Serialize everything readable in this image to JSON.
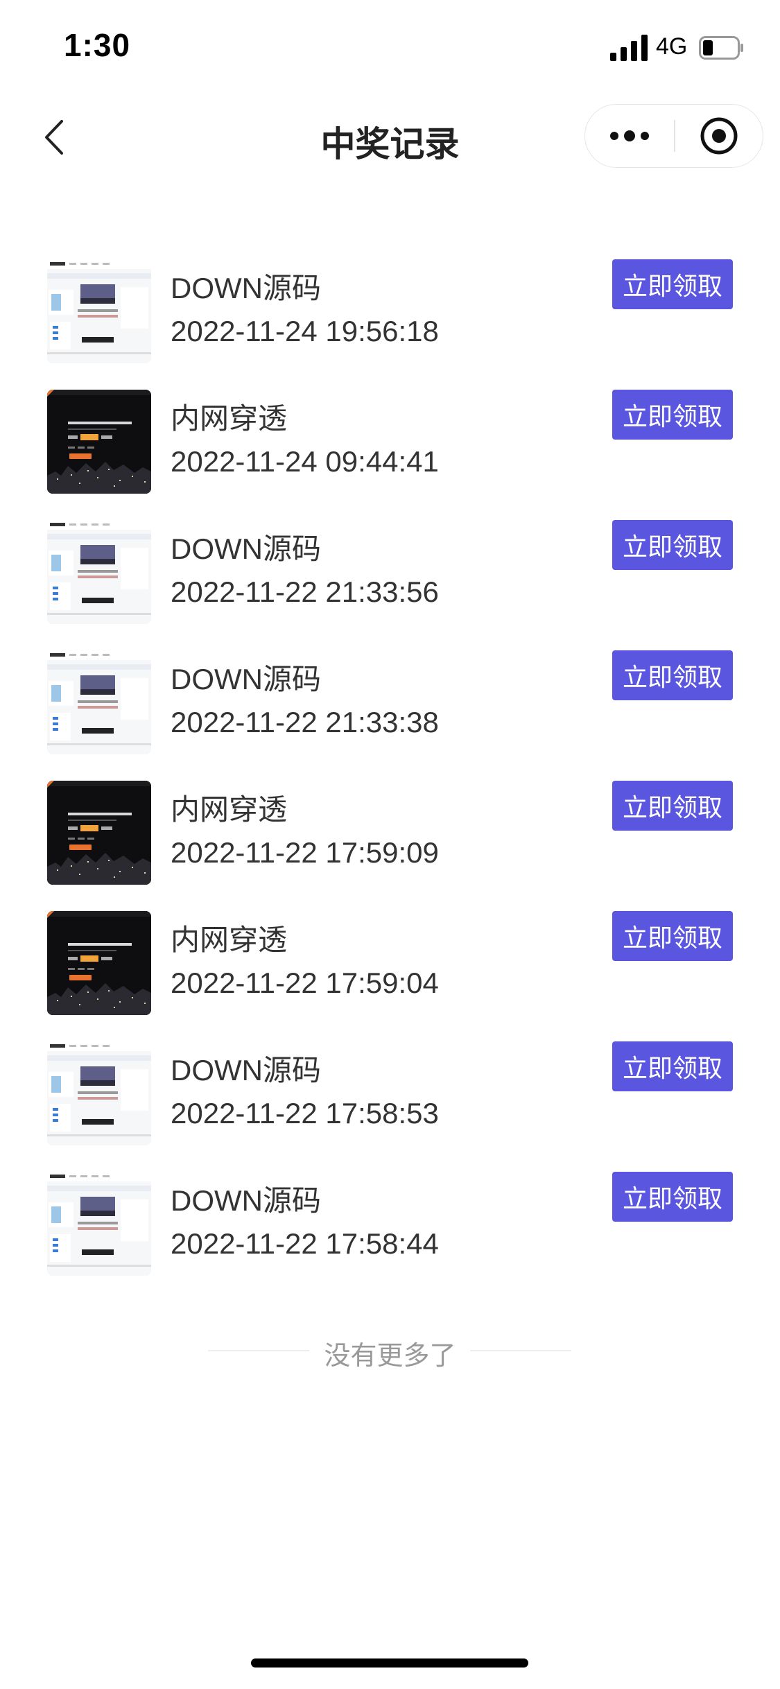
{
  "status_bar": {
    "time": "1:30",
    "network": "4G",
    "icons": [
      "signal-icon",
      "battery-icon"
    ]
  },
  "nav": {
    "title": "中奖记录",
    "icons": [
      "back-icon",
      "more-icon",
      "close-target-icon"
    ]
  },
  "records": [
    {
      "name": "DOWN源码",
      "time": "2022-11-24 19:56:18",
      "thumb": "light",
      "action": "立即领取"
    },
    {
      "name": "内网穿透",
      "time": "2022-11-24 09:44:41",
      "thumb": "dark",
      "action": "立即领取"
    },
    {
      "name": "DOWN源码",
      "time": "2022-11-22 21:33:56",
      "thumb": "light",
      "action": "立即领取"
    },
    {
      "name": "DOWN源码",
      "time": "2022-11-22 21:33:38",
      "thumb": "light",
      "action": "立即领取"
    },
    {
      "name": "内网穿透",
      "time": "2022-11-22 17:59:09",
      "thumb": "dark",
      "action": "立即领取"
    },
    {
      "name": "内网穿透",
      "time": "2022-11-22 17:59:04",
      "thumb": "dark",
      "action": "立即领取"
    },
    {
      "name": "DOWN源码",
      "time": "2022-11-22 17:58:53",
      "thumb": "light",
      "action": "立即领取"
    },
    {
      "name": "DOWN源码",
      "time": "2022-11-22 17:58:44",
      "thumb": "light",
      "action": "立即领取"
    }
  ],
  "footer": {
    "end_text": "没有更多了"
  },
  "colors": {
    "accent": "#5b56e0",
    "text": "#333333",
    "muted": "#999999"
  }
}
